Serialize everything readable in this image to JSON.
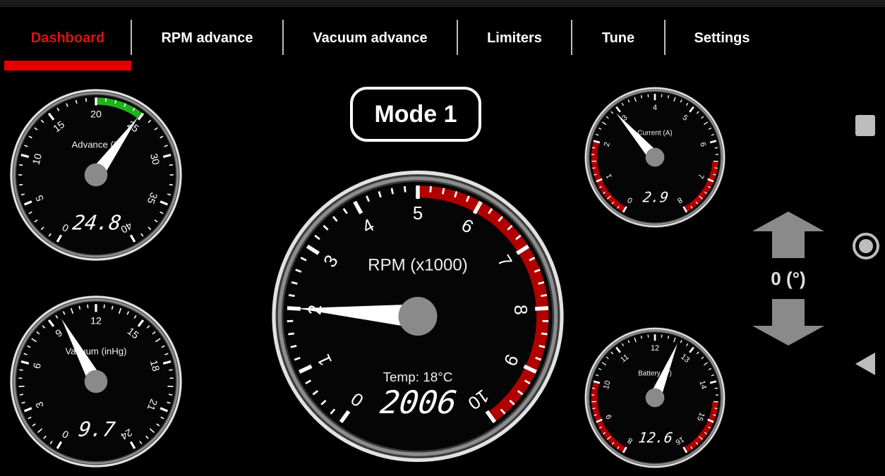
{
  "tabs": [
    {
      "label": "Dashboard",
      "active": true
    },
    {
      "label": "RPM advance",
      "active": false
    },
    {
      "label": "Vacuum advance",
      "active": false
    },
    {
      "label": "Limiters",
      "active": false
    },
    {
      "label": "Tune",
      "active": false
    },
    {
      "label": "Settings",
      "active": false
    }
  ],
  "mode": {
    "label": "Mode 1"
  },
  "gauges": {
    "advance": {
      "label": "Advance (°)",
      "readout": "24.8",
      "value": 24.8,
      "min": 0,
      "max": 40,
      "tick_labels": [
        "0",
        "5",
        "10",
        "15",
        "20",
        "25",
        "30",
        "35",
        "40"
      ],
      "zone": {
        "from": 20,
        "to": 25,
        "color": "#1db31d"
      }
    },
    "vacuum": {
      "label": "Vacuum (inHg)",
      "readout": "9.7",
      "value": 9.7,
      "min": 0,
      "max": 24,
      "tick_labels": [
        "0",
        "3",
        "6",
        "9",
        "12",
        "15",
        "18",
        "21",
        "24"
      ]
    },
    "rpm": {
      "label": "RPM (x1000)",
      "temp": "Temp: 18°C",
      "readout": "2006",
      "value": 2.006,
      "min": 0,
      "max": 10,
      "tick_labels": [
        "0",
        "1",
        "2",
        "3",
        "4",
        "5",
        "6",
        "7",
        "8",
        "9",
        "10"
      ],
      "zone": {
        "from": 5,
        "to": 10,
        "color": "#b00000"
      }
    },
    "current": {
      "label": "Current (A)",
      "readout": "2.9",
      "value": 2.9,
      "min": 0,
      "max": 8,
      "tick_labels": [
        "0",
        "1",
        "2",
        "3",
        "4",
        "5",
        "6",
        "7",
        "8"
      ],
      "zones": [
        {
          "from": 0,
          "to": 2,
          "color": "#b00000"
        },
        {
          "from": 6.5,
          "to": 8,
          "color": "#b00000"
        }
      ]
    },
    "battery": {
      "label": "Battery (V)",
      "readout": "12.6",
      "value": 12.6,
      "min": 8,
      "max": 16,
      "tick_labels": [
        "8",
        "9",
        "10",
        "11",
        "12",
        "13",
        "14",
        "15",
        "16"
      ],
      "zones": [
        {
          "from": 8,
          "to": 10,
          "color": "#b00000"
        },
        {
          "from": 14.5,
          "to": 16,
          "color": "#b00000"
        }
      ]
    }
  },
  "adjust": {
    "value": "0 (°)",
    "up_icon": "arrow-up-icon",
    "down_icon": "arrow-down-icon"
  },
  "navbar": {
    "icons": [
      "square-recents-icon",
      "circle-home-icon",
      "triangle-back-icon"
    ]
  }
}
